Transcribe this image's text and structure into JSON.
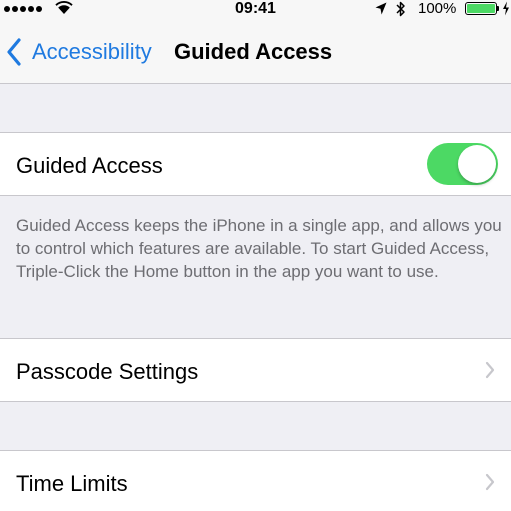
{
  "status_bar": {
    "time": "09:41",
    "battery_percent": "100%",
    "battery_level": 1.0,
    "signal_bars": 5
  },
  "nav": {
    "back_label": "Accessibility",
    "title": "Guided Access"
  },
  "guided_access": {
    "label": "Guided Access",
    "enabled": true,
    "description": "Guided Access keeps the iPhone in a single app, and allows you to control which features are available. To start Guided Access, Triple-Click the Home button in the app you want to use."
  },
  "passcode_settings": {
    "label": "Passcode Settings"
  },
  "time_limits": {
    "label": "Time Limits"
  },
  "colors": {
    "accent": "#1f7ae0",
    "toggle_on": "#4cd964",
    "background": "#efeff4",
    "footer_text": "#6d6d72"
  },
  "icons": {
    "signal": "signal-dots-icon",
    "wifi": "wifi-icon",
    "location": "location-arrow-icon",
    "bluetooth": "bluetooth-icon",
    "battery": "battery-icon",
    "charging": "charging-bolt-icon",
    "back": "chevron-left-icon",
    "disclosure": "chevron-right-icon"
  }
}
